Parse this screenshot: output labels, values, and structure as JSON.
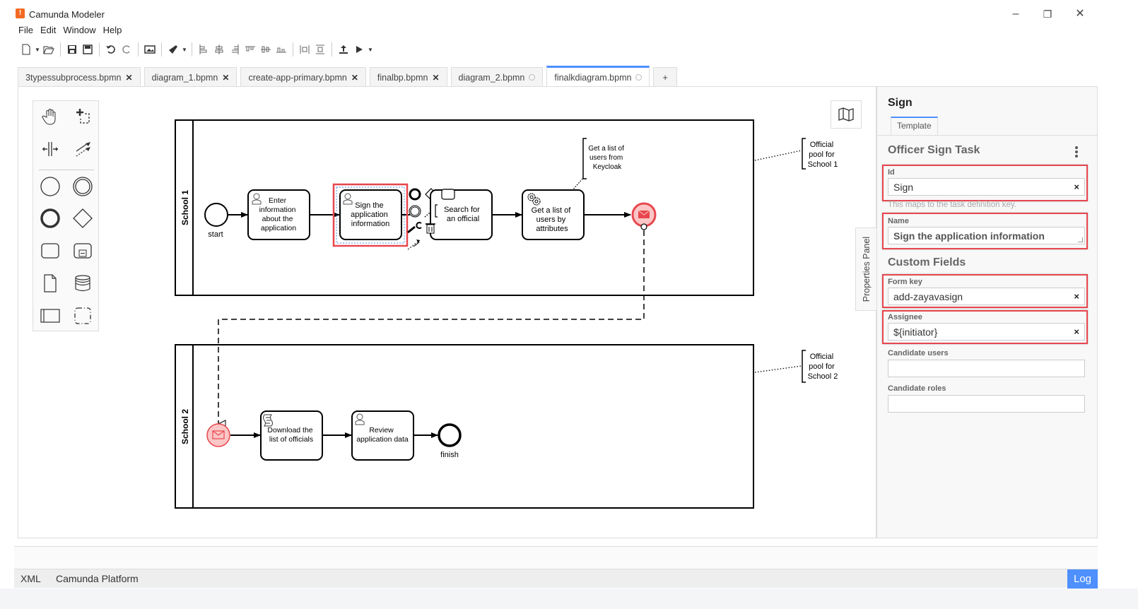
{
  "window": {
    "title": "Camunda Modeler",
    "logo_glyph": "!",
    "controls": {
      "minimize": "–",
      "maximize": "❐",
      "close": "✕"
    }
  },
  "menu": [
    "File",
    "Edit",
    "Window",
    "Help"
  ],
  "toolbar": {
    "icons": [
      "new-file-icon",
      "open-file-icon",
      "save-icon",
      "save-as-icon",
      "undo-icon",
      "redo-icon",
      "export-image-icon",
      "color-picker-icon",
      "align-left-icon",
      "align-center-icon",
      "align-right-icon",
      "align-top-icon",
      "align-middle-icon",
      "align-bottom-icon",
      "distribute-horizontal-icon",
      "distribute-vertical-icon",
      "deploy-icon",
      "start-instance-icon"
    ]
  },
  "tabs": [
    {
      "label": "3typessubprocess.bpmn",
      "state": "close",
      "active": false
    },
    {
      "label": "diagram_1.bpmn",
      "state": "close",
      "active": false
    },
    {
      "label": "create-app-primary.bpmn",
      "state": "close",
      "active": false
    },
    {
      "label": "finalbp.bpmn",
      "state": "close",
      "active": false
    },
    {
      "label": "diagram_2.bpmn",
      "state": "unsaved",
      "active": false
    },
    {
      "label": "finalkdiagram.bpmn",
      "state": "unsaved",
      "active": true
    }
  ],
  "new_tab_label": "+",
  "palette": [
    "hand-tool",
    "lasso-tool",
    "space-tool",
    "global-connect-tool",
    "start-event",
    "intermediate-event",
    "end-event",
    "gateway",
    "task",
    "subprocess",
    "data-object",
    "data-store",
    "participant-pool",
    "group"
  ],
  "diagram": {
    "pools": [
      {
        "name": "School 1",
        "annotation": "Official pool for School 1"
      },
      {
        "name": "School 2",
        "annotation": "Official pool for School 2"
      }
    ],
    "school1": {
      "start_label": "start",
      "task_enter": "Enter information about the application",
      "task_enter_lines": [
        "Enter",
        "information",
        "about the",
        "application"
      ],
      "task_sign_lines": [
        "Sign the",
        "application",
        "information"
      ],
      "task_search_lines": [
        "Search for",
        "an official"
      ],
      "task_getlist_lines": [
        "Get a list of",
        "users by",
        "attributes"
      ],
      "annotation_keycloak_lines": [
        "Get a list of",
        "users from",
        "Keycloak"
      ],
      "annotation_pool_lines": [
        "Official",
        "pool for",
        "School 1"
      ]
    },
    "school2": {
      "task_download_lines": [
        "Download the",
        "list of officials"
      ],
      "task_review_lines": [
        "Review",
        "application data"
      ],
      "finish_label": "finish",
      "annotation_pool_lines": [
        "Official",
        "pool for",
        "School 2"
      ]
    },
    "colors": {
      "selection": "#e8474f",
      "message_event_fill": "#fbc6c6",
      "message_event_stroke": "#e8474f",
      "selection_dash": "#4d90fe"
    }
  },
  "properties_toggle_label": "Properties Panel",
  "properties": {
    "element_title": "Sign",
    "tab_label": "Template",
    "group_title": "Officer Sign Task",
    "id": {
      "label": "Id",
      "value": "Sign",
      "hint": "This maps to the task definition key."
    },
    "name": {
      "label": "Name",
      "value": "Sign the application information"
    },
    "custom_fields_title": "Custom Fields",
    "form_key": {
      "label": "Form key",
      "value": "add-zayavasign"
    },
    "assignee": {
      "label": "Assignee",
      "value": "${initiator}"
    },
    "candidate_users": {
      "label": "Candidate users",
      "value": ""
    },
    "candidate_roles": {
      "label": "Candidate roles",
      "value": ""
    },
    "clear_glyph": "×"
  },
  "statusbar": {
    "xml": "XML",
    "platform": "Camunda Platform",
    "log": "Log"
  },
  "accent_color": "#4d90fe"
}
